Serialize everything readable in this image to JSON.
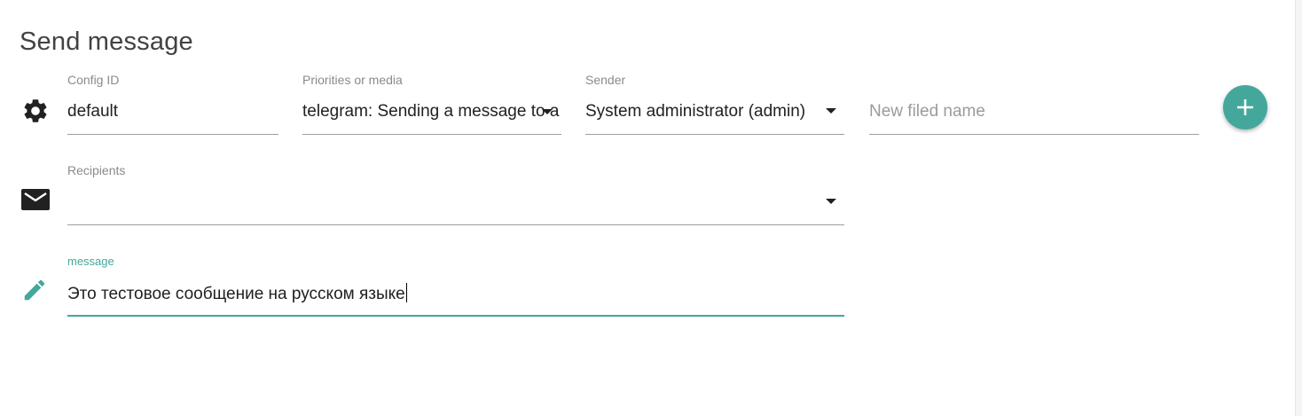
{
  "page": {
    "title": "Send message"
  },
  "fields": {
    "config_id": {
      "label": "Config ID",
      "value": "default"
    },
    "priorities": {
      "label": "Priorities or media",
      "value": "telegram: Sending a message to a"
    },
    "sender": {
      "label": "Sender",
      "value": "System administrator (admin)"
    },
    "new_field": {
      "placeholder": "New filed name"
    },
    "recipients": {
      "label": "Recipients",
      "value": ""
    },
    "message": {
      "label": "message",
      "value": "Это тестовое сообщение на русском языке"
    }
  },
  "icons": {
    "config": "gear-icon",
    "recipients": "mail-icon",
    "message": "pencil-icon",
    "add": "plus-icon"
  },
  "colors": {
    "accent": "#43a89b",
    "text": "#212121",
    "label": "#8a8a8a",
    "underline": "#9e9e9e"
  }
}
